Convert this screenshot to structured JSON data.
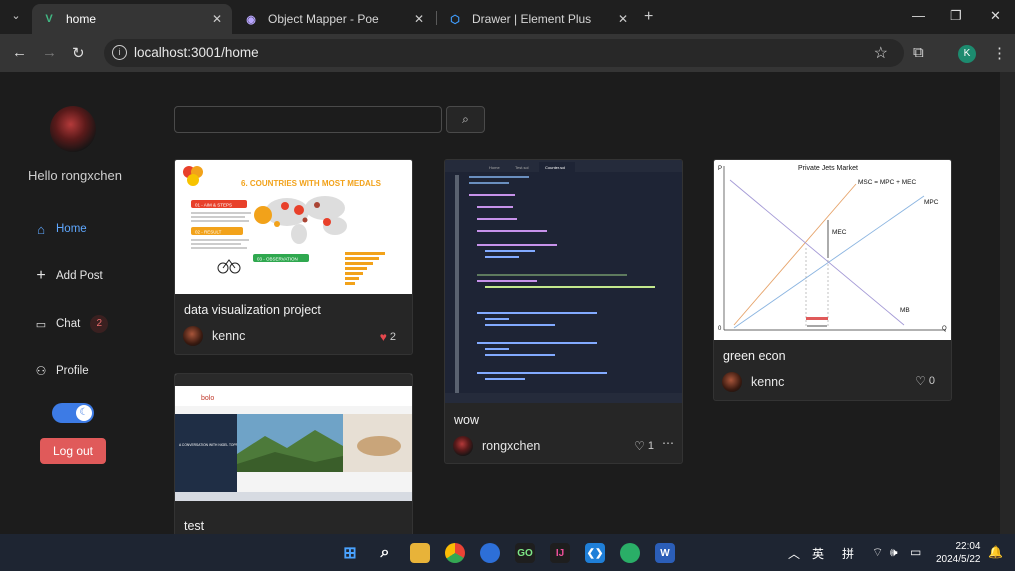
{
  "browser": {
    "tabs": [
      {
        "title": "home",
        "active": true
      },
      {
        "title": "Object Mapper - Poe",
        "active": false
      },
      {
        "title": "Drawer | Element Plus",
        "active": false
      }
    ],
    "url": "localhost:3001/home",
    "profile_initial": "K"
  },
  "sidebar": {
    "greeting": "Hello rongxchen",
    "items": [
      {
        "label": "Home",
        "icon": "home-icon",
        "active": true
      },
      {
        "label": "Add Post",
        "icon": "plus-icon",
        "active": false
      },
      {
        "label": "Chat",
        "icon": "chat-icon",
        "badge": "2",
        "active": false
      },
      {
        "label": "Profile",
        "icon": "user-icon",
        "active": false
      }
    ],
    "theme_toggle": "dark-mode",
    "logout_label": "Log out"
  },
  "search": {
    "placeholder": "",
    "value": ""
  },
  "posts": [
    {
      "title": "data visualization project",
      "author": "kennc",
      "likes": "2",
      "liked": true,
      "thumb_heading": "6. COUNTRIES WITH MOST MEDALS",
      "thumb_steps": [
        "01 - AIM & STEPS",
        "02 - RESULT",
        "03 - OBSERVATION"
      ]
    },
    {
      "title": "test",
      "author": "",
      "likes": "",
      "liked": false,
      "thumb_logo": "bolo",
      "thumb_caption": "A CONVERSATION WITH NIGEL TOPPING ON HIGH LEVEL CLIMATE"
    },
    {
      "title": "wow",
      "author": "rongxchen",
      "likes": "1",
      "liked": false,
      "thumb_tabs": [
        "Home",
        "Test.sol",
        "Counter.sol"
      ]
    },
    {
      "title": "green econ",
      "author": "kennc",
      "likes": "0",
      "liked": false,
      "thumb_chart": {
        "title": "Private Jets Market",
        "labels": [
          "MSC = MPC + MEC",
          "MPC",
          "MEC",
          "MB",
          "P",
          "Q",
          "0"
        ]
      }
    }
  ],
  "taskbar": {
    "ime1": "英",
    "ime2": "拼",
    "time": "22:04",
    "date": "2024/5/22"
  }
}
